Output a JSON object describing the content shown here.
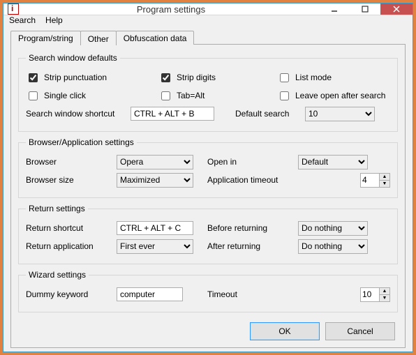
{
  "window": {
    "title": "Program settings"
  },
  "menu": {
    "search": "Search",
    "help": "Help"
  },
  "tabs": {
    "program": "Program/string",
    "other": "Other",
    "obf": "Obfuscation data"
  },
  "grp": {
    "search": "Search window defaults",
    "browser": "Browser/Application settings",
    "return": "Return settings",
    "wizard": "Wizard settings"
  },
  "search": {
    "strip_punct": "Strip punctuation",
    "strip_digits": "Strip digits",
    "list_mode": "List mode",
    "single_click": "Single click",
    "tab_alt": "Tab=Alt",
    "leave_open": "Leave open after search",
    "shortcut_lbl": "Search window shortcut",
    "shortcut_val": "CTRL + ALT + B",
    "default_lbl": "Default search",
    "default_val": "10"
  },
  "browser": {
    "browser_lbl": "Browser",
    "browser_val": "Opera",
    "openin_lbl": "Open in",
    "openin_val": "Default",
    "size_lbl": "Browser size",
    "size_val": "Maximized",
    "timeout_lbl": "Application timeout",
    "timeout_val": "4"
  },
  "return": {
    "shortcut_lbl": "Return shortcut",
    "shortcut_val": "CTRL + ALT + C",
    "before_lbl": "Before returning",
    "before_val": "Do nothing",
    "app_lbl": "Return application",
    "app_val": "First ever",
    "after_lbl": "After returning",
    "after_val": "Do nothing"
  },
  "wizard": {
    "dummy_lbl": "Dummy keyword",
    "dummy_val": "computer",
    "timeout_lbl": "Timeout",
    "timeout_val": "10"
  },
  "buttons": {
    "ok": "OK",
    "cancel": "Cancel"
  }
}
